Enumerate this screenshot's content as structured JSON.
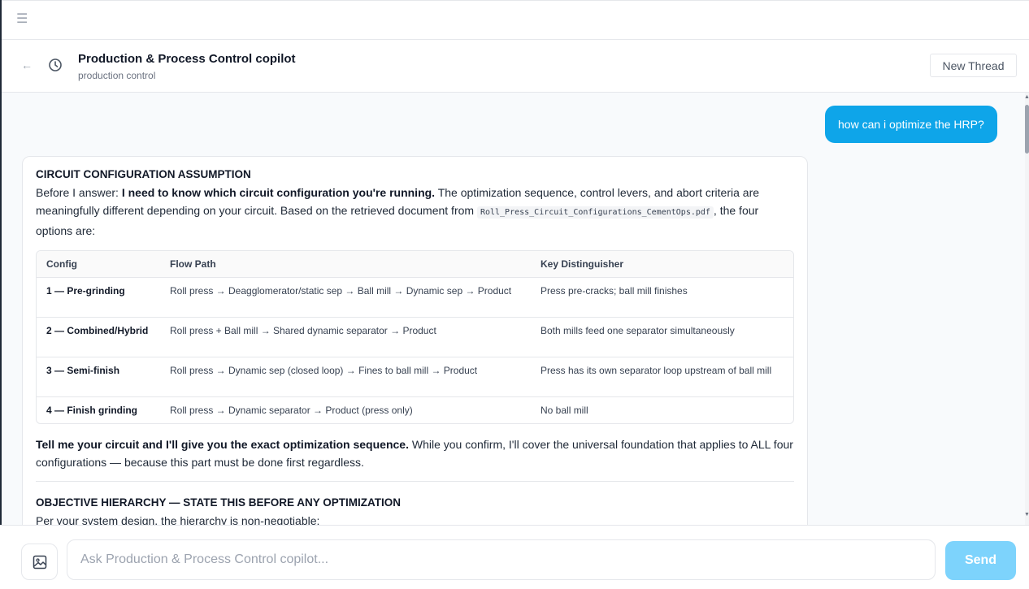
{
  "topbar": {
    "menu_icon": "hamburger-menu-icon"
  },
  "header": {
    "back_icon": "arrow-left-icon",
    "history_icon": "clock-history-icon",
    "title": "Production & Process Control copilot",
    "subtitle": "production control",
    "new_thread_label": "New Thread"
  },
  "colors": {
    "accent": "#0ea5e9",
    "send_disabled": "#7dd3fc"
  },
  "messages": {
    "user": {
      "text": "how can i optimize the HRP?"
    },
    "assistant": {
      "heading1": "CIRCUIT CONFIGURATION ASSUMPTION",
      "intro_prefix": "Before I answer: ",
      "intro_bold": "I need to know which circuit configuration you're running.",
      "intro_rest": " The optimization sequence, control levers, and abort criteria are meaningfully different depending on your circuit. Based on the retrieved document from ",
      "intro_code": "Roll_Press_Circuit_Configurations_CementOps.pdf",
      "intro_suffix": ", the four options are:",
      "table": {
        "headers": [
          "Config",
          "Flow Path",
          "Key Distinguisher"
        ],
        "rows": [
          [
            "1 — Pre-grinding",
            "Roll press → Deagglomerator/static sep → Ball mill → Dynamic sep → Product",
            "Press pre-cracks; ball mill finishes"
          ],
          [
            "2 — Combined/Hybrid",
            "Roll press + Ball mill → Shared dynamic separator → Product",
            "Both mills feed one separator simultaneously"
          ],
          [
            "3 — Semi-finish",
            "Roll press → Dynamic sep (closed loop) → Fines to ball mill → Product",
            "Press has its own separator loop upstream of ball mill"
          ],
          [
            "4 — Finish grinding",
            "Roll press → Dynamic separator → Product (press only)",
            "No ball mill"
          ]
        ]
      },
      "after_bold": "Tell me your circuit and I'll give you the exact optimization sequence.",
      "after_rest": " While you confirm, I'll cover the universal foundation that applies to ALL four configurations — because this part must be done first regardless.",
      "heading2": "OBJECTIVE HIERARCHY — STATE THIS BEFORE ANY OPTIMIZATION",
      "truncated_line": "Per your system design, the hierarchy is non-negotiable:"
    }
  },
  "composer": {
    "image_icon": "image-upload-icon",
    "placeholder": "Ask Production & Process Control copilot...",
    "send_label": "Send"
  }
}
